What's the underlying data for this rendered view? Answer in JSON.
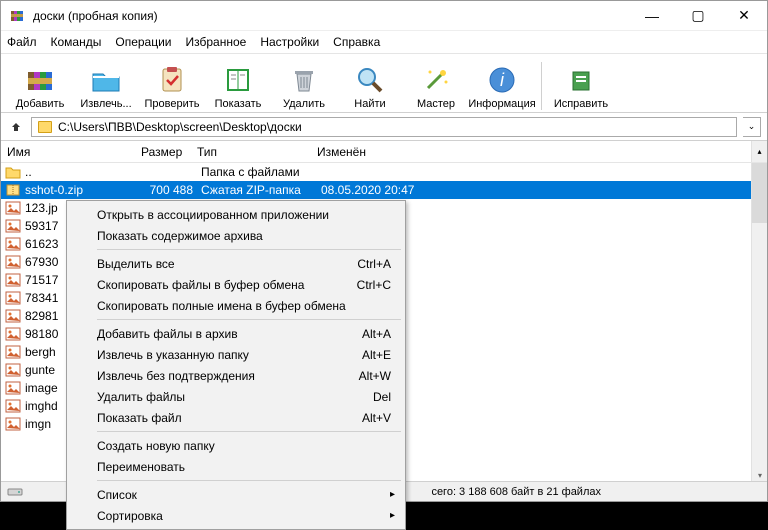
{
  "window": {
    "title": "доски (пробная копия)"
  },
  "menu": {
    "file": "Файл",
    "commands": "Команды",
    "operations": "Операции",
    "favorites": "Избранное",
    "settings": "Настройки",
    "help": "Справка"
  },
  "toolbar": {
    "add": "Добавить",
    "extract": "Извлечь...",
    "test": "Проверить",
    "view": "Показать",
    "delete": "Удалить",
    "find": "Найти",
    "wizard": "Мастер",
    "info": "Информация",
    "repair": "Исправить"
  },
  "address": {
    "path": "C:\\Users\\ПВВ\\Desktop\\screen\\Desktop\\доски"
  },
  "columns": {
    "name": "Имя",
    "size": "Размер",
    "type": "Тип",
    "modified": "Изменён"
  },
  "rows": {
    "parent": {
      "name": "..",
      "type": "Папка с файлами"
    },
    "selected": {
      "name": "sshot-0.zip",
      "size": "700 488",
      "type": "Сжатая ZIP-папка",
      "modified": "08.05.2020 20:47"
    },
    "rest": [
      "123.jp",
      "59317",
      "61623",
      "67930",
      "71517",
      "78341",
      "82981",
      "98180",
      "bergh",
      "gunte",
      "image",
      "imghd",
      "imgn"
    ]
  },
  "context": {
    "open_assoc": "Открыть в ассоциированном приложении",
    "show_contents": "Показать содержимое архива",
    "select_all": {
      "label": "Выделить все",
      "shortcut": "Ctrl+A"
    },
    "copy_files": {
      "label": "Скопировать файлы в буфер обмена",
      "shortcut": "Ctrl+C"
    },
    "copy_paths": "Скопировать полные имена в буфер обмена",
    "add_to_archive": {
      "label": "Добавить файлы в архив",
      "shortcut": "Alt+A"
    },
    "extract_to": {
      "label": "Извлечь в указанную папку",
      "shortcut": "Alt+E"
    },
    "extract_noconfirm": {
      "label": "Извлечь без подтверждения",
      "shortcut": "Alt+W"
    },
    "delete_files": {
      "label": "Удалить файлы",
      "shortcut": "Del"
    },
    "show_file": {
      "label": "Показать файл",
      "shortcut": "Alt+V"
    },
    "new_folder": "Создать новую папку",
    "rename": "Переименовать",
    "list": "Список",
    "sort": "Сортировка"
  },
  "status": {
    "text": "сего: 3 188 608 байт в 21 файлах"
  }
}
